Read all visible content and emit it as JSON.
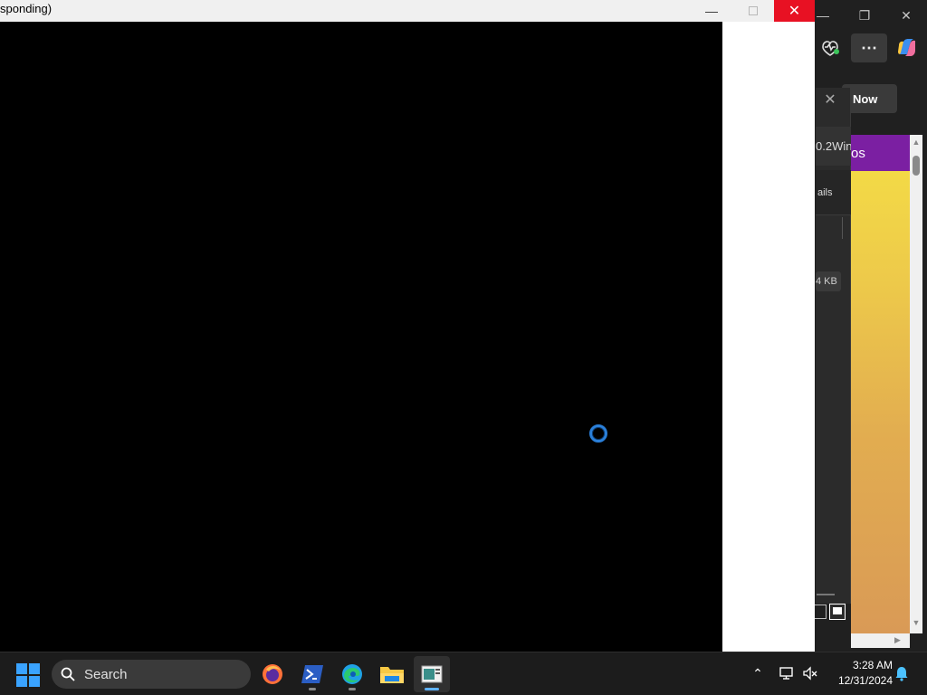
{
  "background_window": {
    "get_now_label": "t Now",
    "panel": {
      "row1_text": "0.2Win",
      "row2_text": "ails",
      "size_text": "4 KB"
    },
    "page_header_text": "os"
  },
  "foreground_window": {
    "title": "sponding)",
    "state": "not responding"
  },
  "taskbar": {
    "search_label": "Search",
    "apps": [
      {
        "name": "Firefox"
      },
      {
        "name": "PowerShell"
      },
      {
        "name": "Microsoft Edge"
      },
      {
        "name": "File Explorer"
      },
      {
        "name": "Active app"
      }
    ],
    "clock_time": "3:28 AM",
    "clock_date": "12/31/2024"
  },
  "colors": {
    "close_red": "#e81123",
    "accent_blue": "#3aa3ff",
    "page_purple": "#7b1fa2"
  }
}
